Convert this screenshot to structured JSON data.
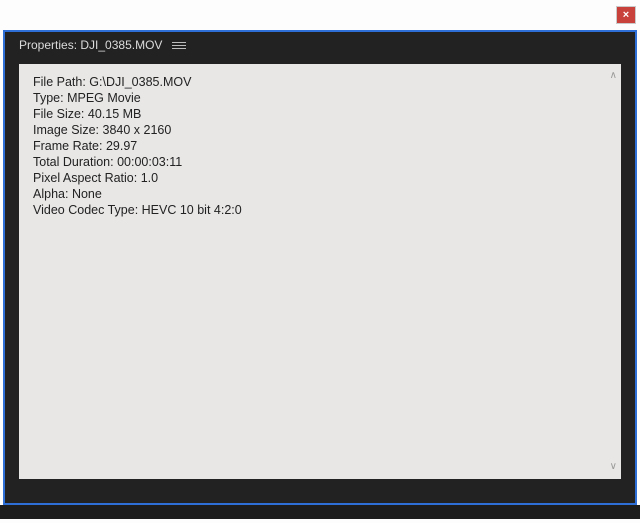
{
  "window": {
    "close_glyph": "×"
  },
  "panel": {
    "title_prefix": "Properties:",
    "filename": "DJI_0385.MOV"
  },
  "properties": {
    "file_path": {
      "label": "File Path:",
      "value": "G:\\DJI_0385.MOV"
    },
    "type": {
      "label": "Type:",
      "value": "MPEG Movie"
    },
    "file_size": {
      "label": "File Size:",
      "value": "40.15 MB"
    },
    "image_size": {
      "label": "Image Size:",
      "value": "3840 x 2160"
    },
    "frame_rate": {
      "label": "Frame Rate:",
      "value": "29.97"
    },
    "total_duration": {
      "label": "Total Duration:",
      "value": "00:00:03:11"
    },
    "pixel_aspect": {
      "label": "Pixel Aspect Ratio:",
      "value": "1.0"
    },
    "alpha": {
      "label": "Alpha:",
      "value": "None"
    },
    "video_codec": {
      "label": "Video Codec Type:",
      "value": "HEVC 10 bit  4:2:0"
    }
  }
}
